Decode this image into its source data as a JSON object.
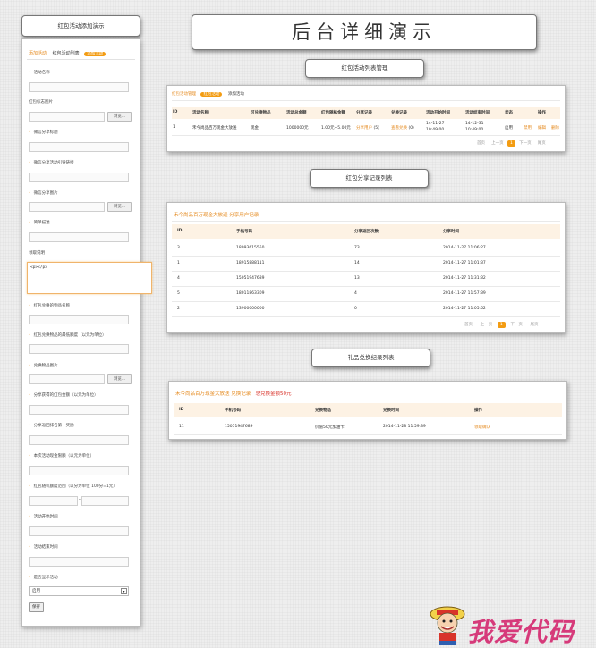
{
  "main_title": "后台详细演示",
  "form": {
    "title": "红包活动添加演示",
    "tabs": [
      "添加活动",
      "红包活动列表",
      "添加活动"
    ],
    "fields": {
      "name": "活动名称",
      "icon": "红包标志图片",
      "share_title": "微信分享标题",
      "share_link": "微信分享活动引导链接",
      "share_pic": "微信分享图片",
      "desc": "简单描述",
      "rule": "领取说明",
      "rule_value": "<p></p>",
      "goods_name": "红包兑换的物品名称",
      "min_amount": "红包兑换物品的最低额度（以元为单位）",
      "goods_pic": "兑换物品图片",
      "share_amount": "分享获得的红包金额（以元为单位）",
      "share_rank": "分享返回排名第一奖励",
      "cash_limit": "本次活动现金限额（以元为单位）",
      "random_range": "红包随机额度范围（以分为单位 100分=1元）",
      "start_time": "活动开始时间",
      "end_time": "活动结束时间",
      "show": "是否显示活动"
    },
    "browse": "浏览...",
    "dash": "-",
    "select_value": "启用",
    "save": "保存"
  },
  "section1": {
    "label": "红包活动列表管理",
    "tabs": [
      "红包活动管理",
      "添加活动"
    ],
    "tab_badge": "红包活动",
    "headers": [
      "ID",
      "活动名称",
      "可兑换物品",
      "活动总金额",
      "红包随机金额",
      "分享记录",
      "兑换记录",
      "活动开始时间",
      "活动结束时间",
      "状态",
      "操作"
    ],
    "row": {
      "id": "1",
      "name": "禾今尚品百万现金大放送",
      "goods": "现金",
      "total": "1000000元",
      "random": "1.00元~5.00元",
      "share": "分享用户",
      "share_count": "(5)",
      "exchange": "查看兑换",
      "exchange_count": "(0)",
      "start_date": "14-11-27",
      "start_time": "10:49:00",
      "end_date": "14-12-31",
      "end_time": "10:49:00",
      "status": "启用",
      "ops": [
        "禁用",
        "编辑",
        "删除"
      ]
    },
    "pager": [
      "首页",
      "上一页",
      "1",
      "下一页",
      "尾页"
    ]
  },
  "section2": {
    "label": "红包分享记录列表",
    "title": "禾今尚品百万现金大放送 分享用户记录",
    "headers": [
      "ID",
      "手机号码",
      "分享返回次数",
      "分享时间"
    ],
    "rows": [
      [
        "3",
        "18993615550",
        "73",
        "2014-11-27 11:06:27"
      ],
      [
        "1",
        "18915888111",
        "14",
        "2014-11-27 11:01:37"
      ],
      [
        "4",
        "15051947689",
        "13",
        "2014-11-27 11:31:32"
      ],
      [
        "5",
        "18011863309",
        "4",
        "2014-11-27 11:57:39"
      ],
      [
        "2",
        "13900000000",
        "0",
        "2014-11-27 11:05:52"
      ]
    ],
    "pager": [
      "首页",
      "上一页",
      "1",
      "下一页",
      "尾页"
    ]
  },
  "section3": {
    "label": "礼品兑换纪录列表",
    "title": "禾今尚品百万现金大放送 兑换记录",
    "total": "总兑换金额50元",
    "headers": [
      "ID",
      "手机号码",
      "兑换物品",
      "兑换时间",
      "操作"
    ],
    "row": [
      "11",
      "15051947689",
      "价值50元加油卡",
      "2014-11-28 11:59:39",
      "领取确认"
    ]
  },
  "watermark": "我爱代码"
}
